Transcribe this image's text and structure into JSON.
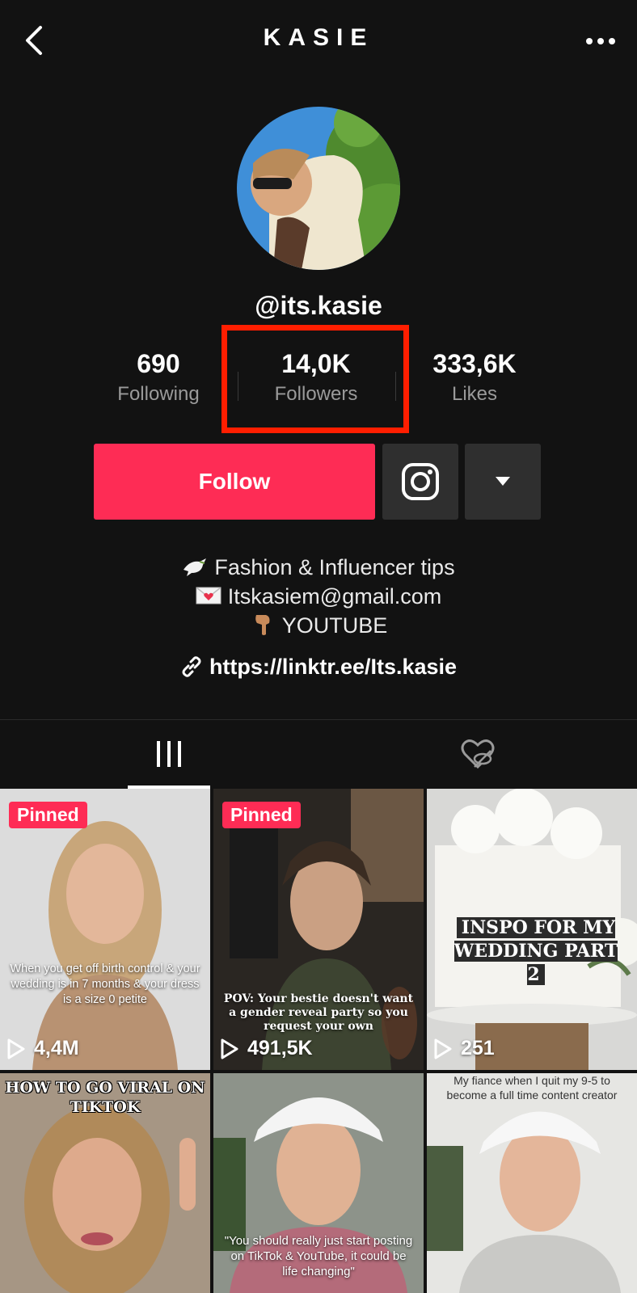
{
  "header": {
    "title": "KASIE",
    "back_icon": "chevron-left-icon",
    "more_icon": "more-horizontal-icon"
  },
  "profile": {
    "handle": "@its.kasie",
    "stats": [
      {
        "value": "690",
        "label": "Following"
      },
      {
        "value": "14,0K",
        "label": "Followers"
      },
      {
        "value": "333,6K",
        "label": "Likes"
      }
    ],
    "follow_label": "Follow",
    "bio": [
      {
        "icon": "dove-emoji",
        "text": "Fashion & Influencer tips"
      },
      {
        "icon": "love-letter-emoji",
        "text": "Itskasiem@gmail.com"
      },
      {
        "icon": "pointing-down-emoji",
        "text": "YOUTUBE"
      }
    ],
    "link": "https://linktr.ee/Its.kasie"
  },
  "tabs": [
    {
      "name": "videos",
      "icon": "grid-bars-icon",
      "active": true
    },
    {
      "name": "liked",
      "icon": "hidden-heart-icon",
      "active": false
    }
  ],
  "videos": [
    {
      "pinned": "Pinned",
      "views": "4,4M",
      "caption": "When you get off birth control & your wedding is in 7 months & your dress is a size 0 petite"
    },
    {
      "pinned": "Pinned",
      "views": "491,5K",
      "caption": "POV: Your bestie doesn't want a gender reveal party so you request your own"
    },
    {
      "pinned": "",
      "views": "251",
      "caption": "INSPO FOR MY WEDDING PART 2"
    },
    {
      "pinned": "",
      "views": "",
      "caption": "HOW TO GO VIRAL ON TIKTOK"
    },
    {
      "pinned": "",
      "views": "",
      "caption": "\"You should really just start posting on TikTok & YouTube, it could be life changing\""
    },
    {
      "pinned": "",
      "views": "",
      "caption": "My fiance when I quit my 9-5 to become a full time content creator"
    }
  ],
  "colors": {
    "background": "#121212",
    "accent": "#fe2c55",
    "highlight_box": "#ff1e00",
    "secondary_text": "#9a9a9a"
  }
}
